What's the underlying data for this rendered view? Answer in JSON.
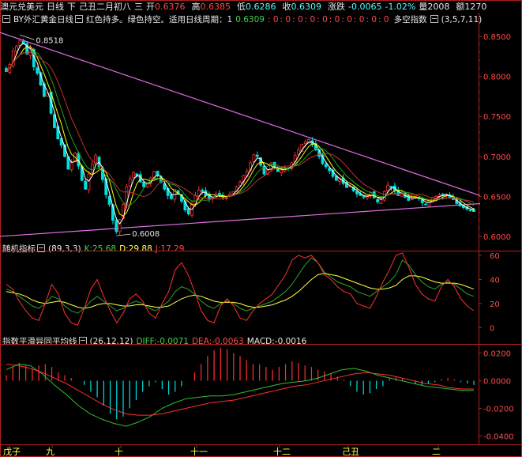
{
  "header": {
    "instrument": "澳元兑美元",
    "period": "日线",
    "direction": "下",
    "date": "己丑二月初八",
    "weekday": "三",
    "open_label": "开",
    "open": "0.6376",
    "high_label": "高",
    "high": "0.6385",
    "low_label": "低",
    "low": "0.6286",
    "close_label": "收",
    "close": "0.6309",
    "change_label": "涨跌",
    "change": "-0.0065",
    "change_pct": "-1.02%",
    "volume_label": "量",
    "volume": "2008",
    "amount_label": "额",
    "amount": "1270"
  },
  "main_panel": {
    "indicator_name": "BY外汇黄金日线",
    "indicator_desc": "红色持多。绿色持空。适用日线周期：1",
    "indicator_value": "0.6309",
    "zero_values": [
      ": 0",
      ": 0",
      ": 0",
      ": 0",
      ": 0",
      ": 0",
      ": 0",
      ": 0",
      ": 0",
      ": 0"
    ],
    "extra_indicator": "多空指数",
    "extra_params": "(3,5,7,11)",
    "y_ticks": [
      "0.8500",
      "0.8000",
      "0.7500",
      "0.7000",
      "0.6500",
      "0.6000"
    ],
    "high_annotation": "0.8518",
    "low_annotation": "0.6008"
  },
  "kdj_panel": {
    "name": "随机指标",
    "params": "(89,3,3)",
    "k_label": "K:25.68",
    "d_label": "D:29.88",
    "j_label": "J:17.29",
    "y_ticks": [
      "60",
      "40",
      "20",
      "0"
    ]
  },
  "macd_panel": {
    "name": "指数平滑异同平均线",
    "params": "(26,12,12)",
    "diff_label": "DIFF:-0.0071",
    "dea_label": "DEA:-0.0063",
    "macd_label": "MACD:-0.0016",
    "y_ticks": [
      "0.0200",
      "0.0000",
      "-0.0200",
      "-0.0400"
    ]
  },
  "x_axis": {
    "labels": [
      "戊子",
      "九",
      "十",
      "十一",
      "十二",
      "己丑",
      "二"
    ]
  },
  "colors": {
    "up_candle": "#ff3030",
    "down_candle": "#00e0e0",
    "bull_bar": "#ff3030",
    "bear_bar": "#00e0e0",
    "ma_white": "#ffffff",
    "ma_yellow": "#ffff00",
    "ma_red": "#c03030",
    "ma_green": "#20a020",
    "trendline": "#e070e0",
    "axis": "#b02020"
  },
  "chart_data": [
    {
      "type": "candlestick",
      "title": "澳元兑美元 日线",
      "ylim": [
        0.595,
        0.86
      ],
      "annotations": [
        {
          "label": "0.8518",
          "value": 0.8518
        },
        {
          "label": "0.6008",
          "value": 0.6008
        }
      ],
      "trendlines": [
        {
          "name": "upper",
          "start": 0.855,
          "end": 0.651
        },
        {
          "name": "lower",
          "start": 0.6,
          "end": 0.641
        }
      ],
      "closes": [
        0.806,
        0.815,
        0.832,
        0.838,
        0.845,
        0.841,
        0.828,
        0.835,
        0.812,
        0.804,
        0.789,
        0.775,
        0.779,
        0.754,
        0.736,
        0.722,
        0.714,
        0.7,
        0.684,
        0.693,
        0.704,
        0.688,
        0.67,
        0.659,
        0.678,
        0.69,
        0.701,
        0.687,
        0.671,
        0.652,
        0.64,
        0.62,
        0.606,
        0.621,
        0.64,
        0.662,
        0.672,
        0.68,
        0.676,
        0.668,
        0.662,
        0.667,
        0.673,
        0.681,
        0.676,
        0.668,
        0.659,
        0.651,
        0.647,
        0.659,
        0.653,
        0.644,
        0.633,
        0.628,
        0.64,
        0.651,
        0.658,
        0.656,
        0.651,
        0.647,
        0.649,
        0.653,
        0.651,
        0.649,
        0.648,
        0.653,
        0.656,
        0.662,
        0.668,
        0.676,
        0.681,
        0.692,
        0.702,
        0.7,
        0.689,
        0.678,
        0.683,
        0.691,
        0.687,
        0.681,
        0.683,
        0.686,
        0.685,
        0.692,
        0.701,
        0.708,
        0.715,
        0.718,
        0.721,
        0.715,
        0.708,
        0.7,
        0.691,
        0.687,
        0.682,
        0.675,
        0.67,
        0.672,
        0.666,
        0.661,
        0.663,
        0.657,
        0.653,
        0.651,
        0.649,
        0.65,
        0.655,
        0.648,
        0.643,
        0.647,
        0.656,
        0.664,
        0.661,
        0.657,
        0.651,
        0.654,
        0.649,
        0.645,
        0.649,
        0.65,
        0.647,
        0.642,
        0.64,
        0.644,
        0.648,
        0.65,
        0.652,
        0.651,
        0.653,
        0.649,
        0.646,
        0.641,
        0.638,
        0.636,
        0.634,
        0.633,
        0.631
      ]
    },
    {
      "type": "line",
      "title": "随机指标",
      "ylim": [
        -5,
        62
      ],
      "series": [
        {
          "name": "K",
          "values": [
            32,
            30,
            26,
            22,
            18,
            16,
            20,
            26,
            24,
            18,
            14,
            12,
            16,
            22,
            26,
            22,
            18,
            14,
            16,
            20,
            22,
            20,
            16,
            14,
            18,
            22,
            30,
            34,
            32,
            28,
            22,
            18,
            16,
            20,
            22,
            20,
            16,
            14,
            16,
            18,
            20,
            22,
            26,
            30,
            36,
            44,
            52,
            58,
            54,
            46,
            42,
            38,
            36,
            34,
            30,
            28,
            26,
            30,
            34,
            38,
            44,
            56,
            52,
            44,
            38,
            34,
            32,
            36,
            38,
            36,
            32,
            28,
            26
          ]
        },
        {
          "name": "D",
          "values": [
            30,
            29,
            28,
            26,
            23,
            21,
            20,
            21,
            22,
            21,
            19,
            17,
            16,
            17,
            19,
            20,
            20,
            19,
            18,
            18,
            19,
            19,
            18,
            17,
            17,
            18,
            21,
            24,
            26,
            27,
            26,
            24,
            22,
            21,
            21,
            21,
            20,
            18,
            17,
            17,
            18,
            19,
            21,
            23,
            26,
            30,
            35,
            40,
            44,
            45,
            44,
            43,
            41,
            39,
            37,
            35,
            33,
            32,
            32,
            33,
            35,
            40,
            43,
            43,
            42,
            40,
            38,
            37,
            37,
            37,
            36,
            34,
            32
          ]
        },
        {
          "name": "J",
          "values": [
            36,
            32,
            22,
            14,
            8,
            6,
            20,
            36,
            28,
            12,
            4,
            2,
            16,
            32,
            40,
            26,
            14,
            4,
            12,
            24,
            28,
            22,
            12,
            8,
            20,
            30,
            48,
            54,
            44,
            30,
            14,
            6,
            4,
            18,
            24,
            18,
            8,
            6,
            14,
            20,
            24,
            28,
            36,
            44,
            56,
            60,
            58,
            60,
            54,
            44,
            40,
            34,
            30,
            28,
            20,
            18,
            16,
            26,
            38,
            48,
            60,
            62,
            50,
            36,
            28,
            24,
            22,
            34,
            40,
            34,
            24,
            18,
            14
          ]
        }
      ]
    },
    {
      "type": "bar",
      "title": "指数平滑异同平均线",
      "ylim": [
        -0.045,
        0.025
      ],
      "series": [
        {
          "name": "MACD",
          "values": [
            0.004,
            0.01,
            0.013,
            0.011,
            0.009,
            0.011,
            0.012,
            0.01,
            0.006,
            0.004,
            0.002,
            0.0,
            -0.003,
            -0.008,
            -0.012,
            -0.018,
            -0.024,
            -0.028,
            -0.026,
            -0.02,
            -0.014,
            -0.008,
            -0.004,
            -0.001,
            -0.006,
            -0.01,
            -0.008,
            -0.004,
            0.0,
            0.006,
            0.012,
            0.018,
            0.022,
            0.024,
            0.023,
            0.02,
            0.018,
            0.015,
            0.012,
            0.012,
            0.01,
            0.008,
            0.01,
            0.012,
            0.014,
            0.013,
            0.011,
            0.01,
            0.008,
            0.007,
            0.005,
            0.003,
            0.001,
            -0.004,
            -0.008,
            -0.01,
            -0.009,
            -0.006,
            -0.004,
            0.002,
            0.003,
            0.002,
            0.0,
            -0.002,
            -0.003,
            -0.002,
            -0.001,
            0.001,
            0.002,
            0.001,
            -0.001,
            -0.002,
            -0.003
          ]
        },
        {
          "name": "DIFF",
          "values": [
            0.008,
            0.012,
            0.011,
            0.005,
            -0.003,
            -0.01,
            -0.018,
            -0.024,
            -0.028,
            -0.031,
            -0.033,
            -0.03,
            -0.026,
            -0.02,
            -0.016,
            -0.013,
            -0.012,
            -0.011,
            -0.011,
            -0.01,
            -0.008,
            -0.006,
            -0.004,
            -0.002,
            -0.001,
            0.0,
            0.002,
            0.005,
            0.008,
            0.009,
            0.007,
            0.004,
            0.002,
            0.0,
            -0.002,
            -0.004,
            -0.005,
            -0.006,
            -0.007,
            -0.007
          ]
        },
        {
          "name": "DEA",
          "values": [
            0.012,
            0.011,
            0.009,
            0.006,
            0.002,
            -0.002,
            -0.007,
            -0.012,
            -0.017,
            -0.021,
            -0.024,
            -0.025,
            -0.025,
            -0.024,
            -0.022,
            -0.02,
            -0.018,
            -0.016,
            -0.015,
            -0.014,
            -0.012,
            -0.01,
            -0.008,
            -0.006,
            -0.004,
            -0.003,
            -0.001,
            0.001,
            0.003,
            0.005,
            0.006,
            0.005,
            0.004,
            0.002,
            0.0,
            -0.002,
            -0.003,
            -0.005,
            -0.006,
            -0.006
          ]
        }
      ]
    }
  ]
}
